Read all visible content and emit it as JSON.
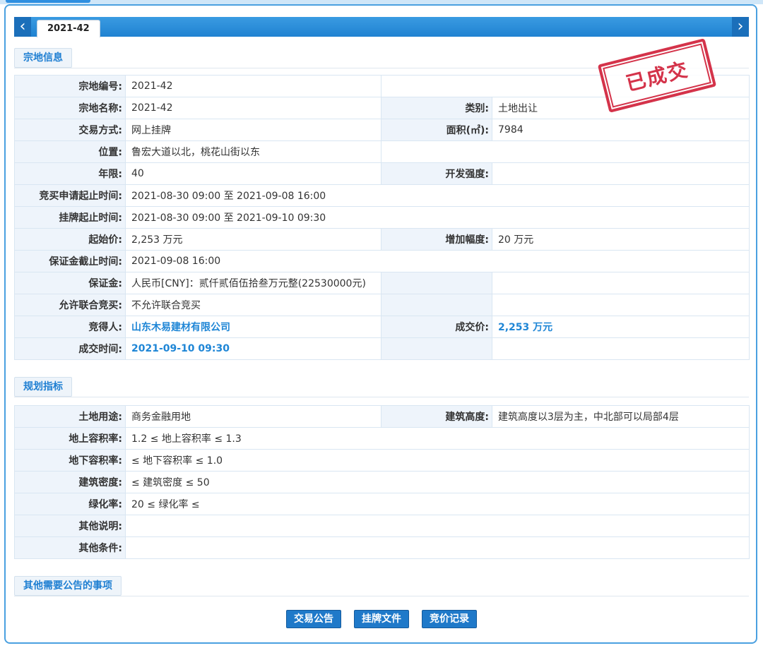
{
  "tab": {
    "label": "2021-42"
  },
  "stamp": {
    "text": "已成交"
  },
  "sections": {
    "land_info": "宗地信息",
    "planning": "规划指标",
    "other_matters": "其他需要公告的事项"
  },
  "land": {
    "code_label": "宗地编号:",
    "code": "2021-42",
    "name_label": "宗地名称:",
    "name": "2021-42",
    "category_label": "类别:",
    "category": "土地出让",
    "method_label": "交易方式:",
    "method": "网上挂牌",
    "area_label": "面积(㎡):",
    "area": "7984",
    "location_label": "位置:",
    "location": "鲁宏大道以北，桃花山街以东",
    "term_label": "年限:",
    "term": "40",
    "intensity_label": "开发强度:",
    "intensity": "",
    "apply_time_label": "竞买申请起止时间:",
    "apply_time": "2021-08-30 09:00 至 2021-09-08 16:00",
    "listing_time_label": "挂牌起止时间:",
    "listing_time": "2021-08-30 09:00 至 2021-09-10 09:30",
    "start_price_label": "起始价:",
    "start_price": "2,253 万元",
    "increment_label": "增加幅度:",
    "increment": "20 万元",
    "deposit_deadline_label": "保证金截止时间:",
    "deposit_deadline": "2021-09-08 16:00",
    "deposit_label": "保证金:",
    "deposit": "人民币[CNY]：贰仟贰佰伍拾叁万元整(22530000元)",
    "joint_label": "允许联合竞买:",
    "joint": "不允许联合竞买",
    "winner_label": "竞得人:",
    "winner": "山东木易建材有限公司",
    "deal_price_label": "成交价:",
    "deal_price": "2,253 万元",
    "deal_time_label": "成交时间:",
    "deal_time": "2021-09-10 09:30"
  },
  "plan": {
    "use_label": "土地用途:",
    "use": "商务金融用地",
    "height_label": "建筑高度:",
    "height": "建筑高度以3层为主，中北部可以局部4层",
    "far_above_label": "地上容积率:",
    "far_above": "1.2 ≤ 地上容积率 ≤ 1.3",
    "far_below_label": "地下容积率:",
    "far_below": "≤ 地下容积率 ≤ 1.0",
    "density_label": "建筑密度:",
    "density": "≤ 建筑密度 ≤ 50",
    "green_label": "绿化率:",
    "green": "20 ≤ 绿化率 ≤",
    "other_note_label": "其他说明:",
    "other_note": "",
    "other_cond_label": "其他条件:",
    "other_cond": ""
  },
  "buttons": {
    "announcement": "交易公告",
    "listing_docs": "挂牌文件",
    "bid_records": "竞价记录"
  }
}
